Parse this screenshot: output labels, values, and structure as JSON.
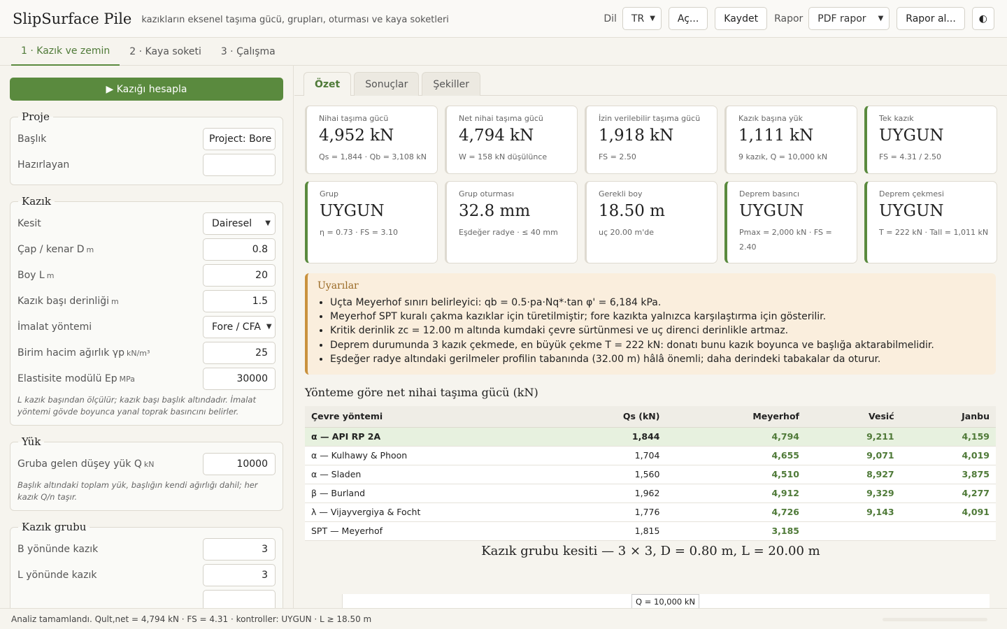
{
  "header": {
    "title": "SlipSurface Pile",
    "subtitle": "kazıkların eksenel taşıma gücü, grupları, oturması ve kaya soketleri",
    "lang_label": "Dil",
    "lang_value": "TR",
    "open_label": "Aç...",
    "save_label": "Kaydet",
    "report_label": "Rapor",
    "report_value": "PDF rapor",
    "report_btn": "Rapor al...",
    "theme_icon": "◐"
  },
  "tabs": [
    "1 · Kazık ve zemin",
    "2 · Kaya soketi",
    "3 · Çalışma"
  ],
  "left": {
    "run_label": "▶ Kazığı hesapla",
    "proje": {
      "legend": "Proje",
      "baslik_label": "Başlık",
      "baslik_value": "Project: Bore",
      "hazirlayan_label": "Hazırlayan",
      "hazirlayan_value": ""
    },
    "kazik": {
      "legend": "Kazık",
      "kesit_label": "Kesit",
      "kesit_value": "Dairesel",
      "cap_label": "Çap / kenar D",
      "cap_unit": "m",
      "cap_value": "0.8",
      "boy_label": "Boy L",
      "boy_unit": "m",
      "boy_value": "20",
      "bas_label": "Kazık başı derinliği",
      "bas_unit": "m",
      "bas_value": "1.5",
      "imalat_label": "İmalat yöntemi",
      "imalat_value": "Fore / CFA",
      "birim_label": "Birim hacim ağırlık γp",
      "birim_unit": "kN/m³",
      "birim_value": "25",
      "ep_label": "Elastisite modülü Ep",
      "ep_unit": "MPa",
      "ep_value": "30000",
      "note": "L kazık başından ölçülür; kazık başı başlık altındadır. İmalat yöntemi gövde boyunca yanal toprak basıncını belirler."
    },
    "yuk": {
      "legend": "Yük",
      "q_label": "Gruba gelen düşey yük Q",
      "q_unit": "kN",
      "q_value": "10000",
      "note": "Başlık altındaki toplam yük, başlığın kendi ağırlığı dahil; her kazık Q/n taşır."
    },
    "grup": {
      "legend": "Kazık grubu",
      "b_label": "B yönünde kazık",
      "b_value": "3",
      "l_label": "L yönünde kazık",
      "l_value": "3"
    }
  },
  "right": {
    "tabs": [
      "Özet",
      "Sonuçlar",
      "Şekiller"
    ],
    "cards": [
      {
        "title": "Nihai taşıma gücü",
        "value": "4,952 kN",
        "sub": "Qs = 1,844 · Qb = 3,108 kN"
      },
      {
        "title": "Net nihai taşıma gücü",
        "value": "4,794 kN",
        "sub": "W = 158 kN düşülünce"
      },
      {
        "title": "İzin verilebilir taşıma gücü",
        "value": "1,918 kN",
        "sub": "FS = 2.50"
      },
      {
        "title": "Kazık başına yük",
        "value": "1,111 kN",
        "sub": "9 kazık, Q = 10,000 kN"
      },
      {
        "title": "Tek kazık",
        "value": "UYGUN",
        "sub": "FS = 4.31 / 2.50"
      },
      {
        "title": "Grup",
        "value": "UYGUN",
        "sub": "η = 0.73 · FS = 3.10"
      },
      {
        "title": "Grup oturması",
        "value": "32.8 mm",
        "sub": "Eşdeğer radye · ≤ 40 mm"
      },
      {
        "title": "Gerekli boy",
        "value": "18.50 m",
        "sub": "uç 20.00 m'de"
      },
      {
        "title": "Deprem basıncı",
        "value": "UYGUN",
        "sub": "Pmax = 2,000 kN · FS = 2.40"
      },
      {
        "title": "Deprem çekmesi",
        "value": "UYGUN",
        "sub": "T = 222 kN · Tall = 1,011 kN"
      }
    ],
    "warnings": {
      "title": "Uyarılar",
      "items": [
        "Uçta Meyerhof sınırı belirleyici: qb = 0.5·pa·Nq*·tan φ' = 6,184 kPa.",
        "Meyerhof SPT kuralı çakma kazıklar için türetilmiştir; fore kazıkta yalnızca karşılaştırma için gösterilir.",
        "Kritik derinlik zc = 12.00 m altında kumdaki çevre sürtünmesi ve uç direnci derinlikle artmaz.",
        "Deprem durumunda 3 kazık çekmede, en büyük çekme T = 222 kN: donatı bunu kazık boyunca ve başlığa aktarabilmelidir.",
        "Eşdeğer radye altındaki gerilmeler profilin tabanında (32.00 m) hâlâ önemli; daha derindeki tabakalar da oturur."
      ]
    },
    "table": {
      "title": "Yönteme göre net nihai taşıma gücü (kN)",
      "headers": [
        "Çevre yöntemi",
        "Qs (kN)",
        "Meyerhof",
        "Vesić",
        "Janbu"
      ],
      "rows": [
        [
          "α — API RP 2A",
          "1,844",
          "4,794",
          "9,211",
          "4,159"
        ],
        [
          "α — Kulhawy & Phoon",
          "1,704",
          "4,655",
          "9,071",
          "4,019"
        ],
        [
          "α — Sladen",
          "1,560",
          "4,510",
          "8,927",
          "3,875"
        ],
        [
          "β — Burland",
          "1,962",
          "4,912",
          "9,329",
          "4,277"
        ],
        [
          "λ — Vijayvergiya & Focht",
          "1,776",
          "4,726",
          "9,143",
          "4,091"
        ],
        [
          "SPT — Meyerhof",
          "1,815",
          "3,185",
          "",
          ""
        ]
      ]
    },
    "figure": {
      "title": "Kazık grubu kesiti — 3 × 3, D = 0.80 m, L = 20.00 m",
      "q_label": "Q = 10,000 kN"
    }
  },
  "status": "Analiz tamamlandı. Qult,net = 4,794 kN · FS = 4.31 · kontroller: UYGUN · L ≥ 18.50 m",
  "colors": {
    "accent": "#5a8a3e",
    "warn": "#c9923e"
  }
}
